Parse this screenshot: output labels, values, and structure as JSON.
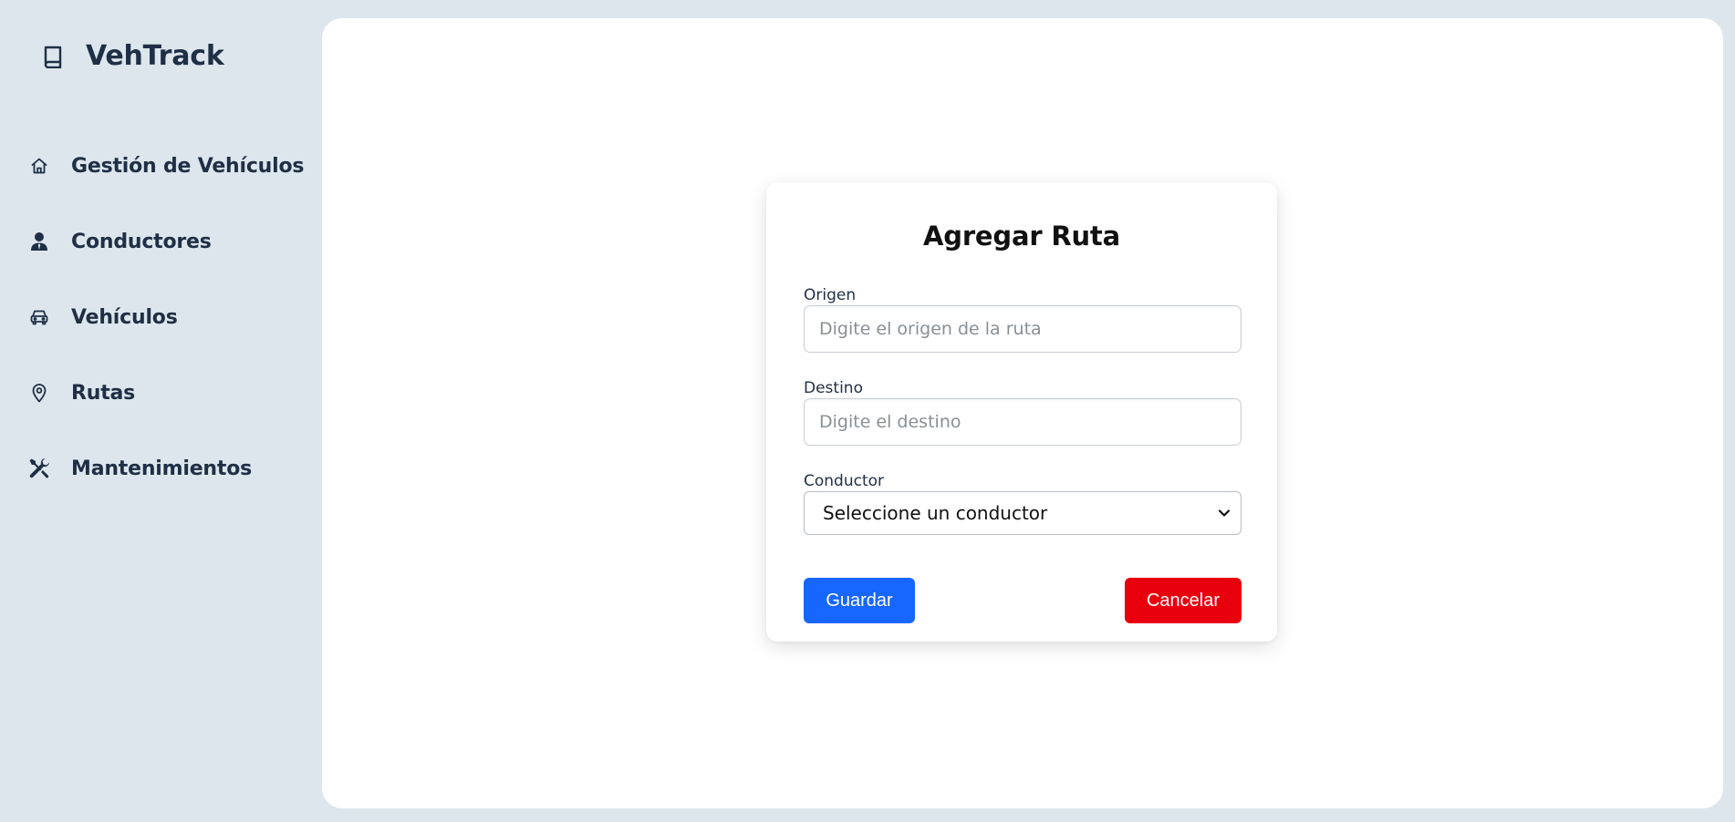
{
  "app": {
    "title": "VehTrack"
  },
  "sidebar": {
    "items": [
      {
        "label": "Gestión de Vehículos",
        "icon": "home-icon"
      },
      {
        "label": "Conductores",
        "icon": "user-icon"
      },
      {
        "label": "Vehículos",
        "icon": "car-icon"
      },
      {
        "label": "Rutas",
        "icon": "map-pin-icon"
      },
      {
        "label": "Mantenimientos",
        "icon": "tools-icon"
      }
    ]
  },
  "form": {
    "title": "Agregar Ruta",
    "origin": {
      "label": "Origen",
      "value": "",
      "placeholder": "Digite el origen de la ruta"
    },
    "destination": {
      "label": "Destino",
      "value": "",
      "placeholder": "Digite el destino"
    },
    "driver": {
      "label": "Conductor",
      "selected": "Seleccione un conductor"
    },
    "save_label": "Guardar",
    "cancel_label": "Cancelar"
  },
  "colors": {
    "background": "#dde6ed",
    "text": "#1f2f45",
    "save_button": "#1766ff",
    "cancel_button": "#e8000d",
    "panel": "#ffffff"
  }
}
